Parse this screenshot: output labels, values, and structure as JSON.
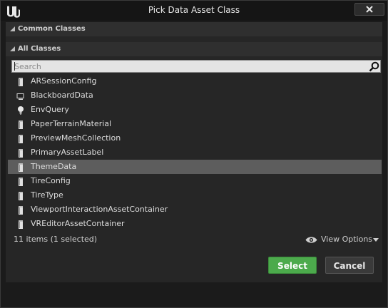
{
  "window": {
    "title": "Pick Data Asset Class"
  },
  "sections": {
    "common": "Common Classes",
    "all": "All Classes"
  },
  "search": {
    "placeholder": "Search",
    "value": ""
  },
  "classes": [
    {
      "label": "ARSessionConfig",
      "icon": "data-asset-icon"
    },
    {
      "label": "BlackboardData",
      "icon": "monitor-icon"
    },
    {
      "label": "EnvQuery",
      "icon": "lightbulb-icon"
    },
    {
      "label": "PaperTerrainMaterial",
      "icon": "data-asset-icon"
    },
    {
      "label": "PreviewMeshCollection",
      "icon": "data-asset-icon"
    },
    {
      "label": "PrimaryAssetLabel",
      "icon": "data-asset-icon"
    },
    {
      "label": "ThemeData",
      "icon": "data-asset-icon",
      "selected": true
    },
    {
      "label": "TireConfig",
      "icon": "data-asset-icon"
    },
    {
      "label": "TireType",
      "icon": "data-asset-icon"
    },
    {
      "label": "ViewportInteractionAssetContainer",
      "icon": "data-asset-icon"
    },
    {
      "label": "VREditorAssetContainer",
      "icon": "data-asset-icon"
    }
  ],
  "status": {
    "summary": "11 items (1 selected)"
  },
  "view_options": {
    "label": "View Options",
    "icon": "eye-icon"
  },
  "buttons": {
    "select": "Select",
    "cancel": "Cancel"
  },
  "colors": {
    "select_button": "#4caa4c",
    "selected_row": "#5d5d5d",
    "background": "#1b1b1b",
    "panel": "#262626"
  }
}
